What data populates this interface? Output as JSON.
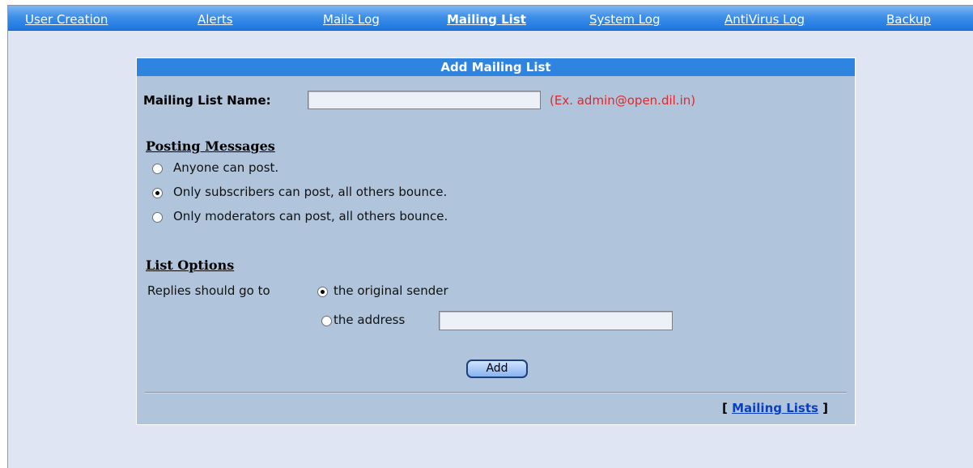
{
  "nav": {
    "items": [
      {
        "label": "User Creation",
        "active": false
      },
      {
        "label": "Alerts",
        "active": false
      },
      {
        "label": "Mails Log",
        "active": false
      },
      {
        "label": "Mailing List",
        "active": true
      },
      {
        "label": "System Log",
        "active": false
      },
      {
        "label": "AntiVirus Log",
        "active": false
      },
      {
        "label": "Backup",
        "active": false
      }
    ]
  },
  "form": {
    "title": "Add Mailing List",
    "name_label": "Mailing List Name:",
    "name_value": "",
    "name_hint": "(Ex. admin@open.dil.in)",
    "posting": {
      "title": "Posting Messages",
      "options": [
        {
          "label": "Anyone can post.",
          "checked": false
        },
        {
          "label": "Only subscribers can post, all others bounce.",
          "checked": true
        },
        {
          "label": "Only moderators can post, all others bounce.",
          "checked": false
        }
      ]
    },
    "list_options": {
      "title": "List Options",
      "replies_label": "Replies should go to",
      "reply_options": [
        {
          "label": "the original sender",
          "checked": true
        },
        {
          "label": "the address",
          "checked": false
        }
      ],
      "address_value": ""
    },
    "add_button": "Add",
    "footer": {
      "open_bracket": "[",
      "link": "Mailing Lists",
      "close_bracket": "]"
    }
  },
  "colors": {
    "nav_bg": "#1d76e0",
    "page_bg": "#dfe5f3",
    "panel_bg": "#b0c5dc",
    "header_bg": "#2f84e0",
    "hint_text": "#e0282a",
    "link": "#0a3fc0"
  }
}
